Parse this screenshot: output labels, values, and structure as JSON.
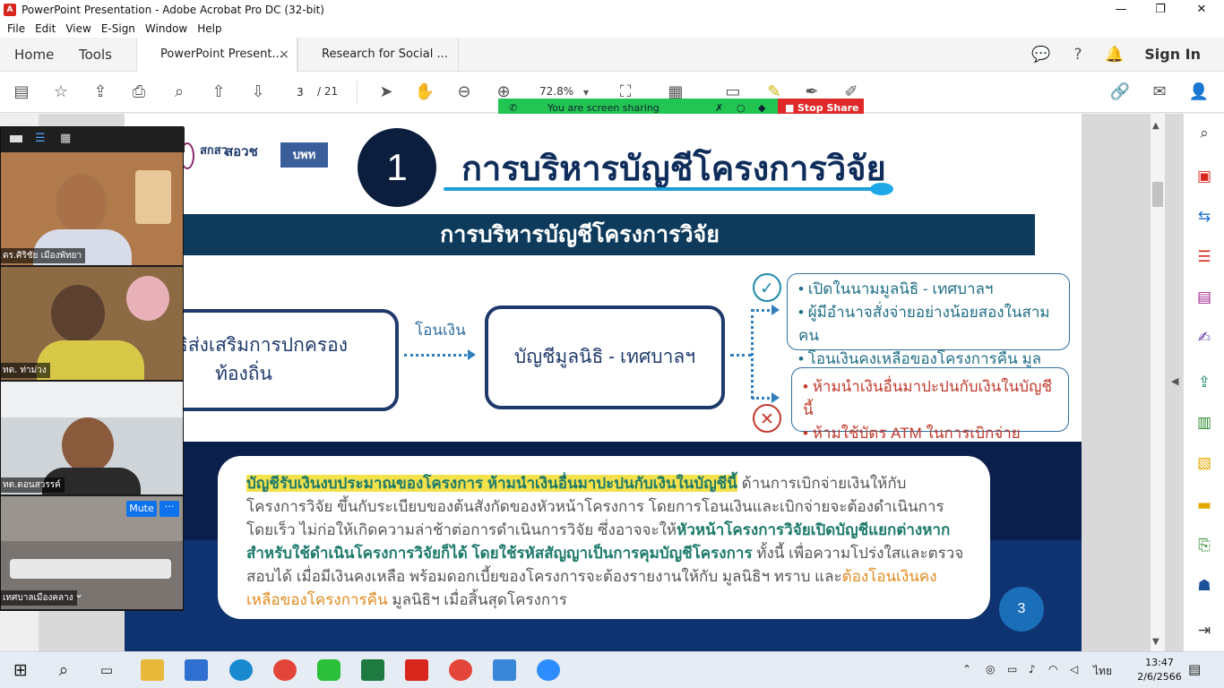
{
  "window": {
    "title": "PowerPoint Presentation - Adobe Acrobat Pro DC (32-bit)",
    "controls": {
      "minimize": "—",
      "maximize": "❐",
      "close": "✕"
    }
  },
  "menu": [
    "File",
    "Edit",
    "View",
    "E-Sign",
    "Window",
    "Help"
  ],
  "tabs": {
    "home": "Home",
    "tools": "Tools",
    "documents": [
      {
        "label": "PowerPoint Present...",
        "close": "×"
      },
      {
        "label": "Research for Social ..."
      }
    ],
    "sign_in": "Sign In"
  },
  "toolbar": {
    "current_page": "3",
    "total_pages": "/ 21",
    "zoom": "72.8%"
  },
  "screen_share": {
    "status": "You are screen sharing",
    "stop_label": "Stop Share"
  },
  "slide": {
    "number_badge": "1",
    "main_title": "การบริหารบัญชีโครงการวิจัย",
    "banner_title": "การบริหารบัญชีโครงการวิจัย",
    "logos": [
      "สกสว",
      "สอวช",
      "บพท"
    ],
    "box_left": "มูลนิธิส่งเสริมการปกครอง\nท้องถิ่น",
    "flow_label": "โอนเงิน",
    "box_center": "บัญชีมูลนิธิ - เทศบาลฯ",
    "allowed": [
      "เปิดในนามมูลนิธิ - เทศบาลฯ",
      "ผู้มีอำนาจสั่งจ่ายอย่างน้อยสองในสามคน",
      "โอนเงินคงเหลือของโครงการคืน มูลนิธิฯ"
    ],
    "forbidden": [
      "ห้ามนำเงินอื่นมาปะปนกับเงินในบัญชีนี้",
      "ห้ามใช้บัตร ATM ในการเบิกจ่าย"
    ],
    "note": {
      "highlight": "บัญชีรับเงินงบประมาณของโครงการ ห้ามนำเงินอื่นมาปะปนกับเงินในบัญชีนี้",
      "text1": " ด้านการเบิกจ่ายเงินให้กับโครงการวิจัย ขึ้นกับระเบียบของต้นสังกัดของหัวหน้าโครงการ โดยการโอนเงินและเบิกจ่ายจะต้องดำเนินการโดยเร็ว ไม่ก่อให้เกิดความล่าช้าต่อการดำเนินการวิจัย ซึ่งอาจจะให้",
      "teal": "หัวหน้าโครงการวิจัยเปิดบัญชีแยกต่างหากสำหรับใช้ดำเนินโครงการวิจัยก็ได้ โดยใช้รหัสสัญญาเป็นการคุมบัญชีโครงการ",
      "text2": " ทั้งนี้ เพื่อความโปร่งใสและตรวจสอบได้ เมื่อมีเงินคงเหลือ พร้อมดอกเบี้ยของโครงการจะต้องรายงานให้กับ มูลนิธิฯ ทราบ และ",
      "orange": "ต้องโอนเงินคงเหลือของโครงการคืน",
      "text3": " มูลนิธิฯ เมื่อสิ้นสุดโครงการ"
    },
    "page_badge": "3"
  },
  "video_panel": {
    "participants": [
      {
        "name": "ดร.ศิริชัย เมืองพัทยา"
      },
      {
        "name": "ทต. ท่าม่วง"
      },
      {
        "name": "ทต.ดอนสวรรค์"
      },
      {
        "name": "เทศบาลเมืองคลาง"
      }
    ],
    "mute_label": "Mute",
    "more_label": "···"
  },
  "taskbar": {
    "language": "ไทย",
    "time": "13:47",
    "date": "2/6/2566"
  },
  "colors": {
    "acrobat_red": "#d9261c",
    "slide_navy": "#0e3b5b",
    "title_blue": "#0f2d5b",
    "share_green": "#23c552",
    "stop_red": "#e02828",
    "zoom_blue": "#0e72ed"
  }
}
